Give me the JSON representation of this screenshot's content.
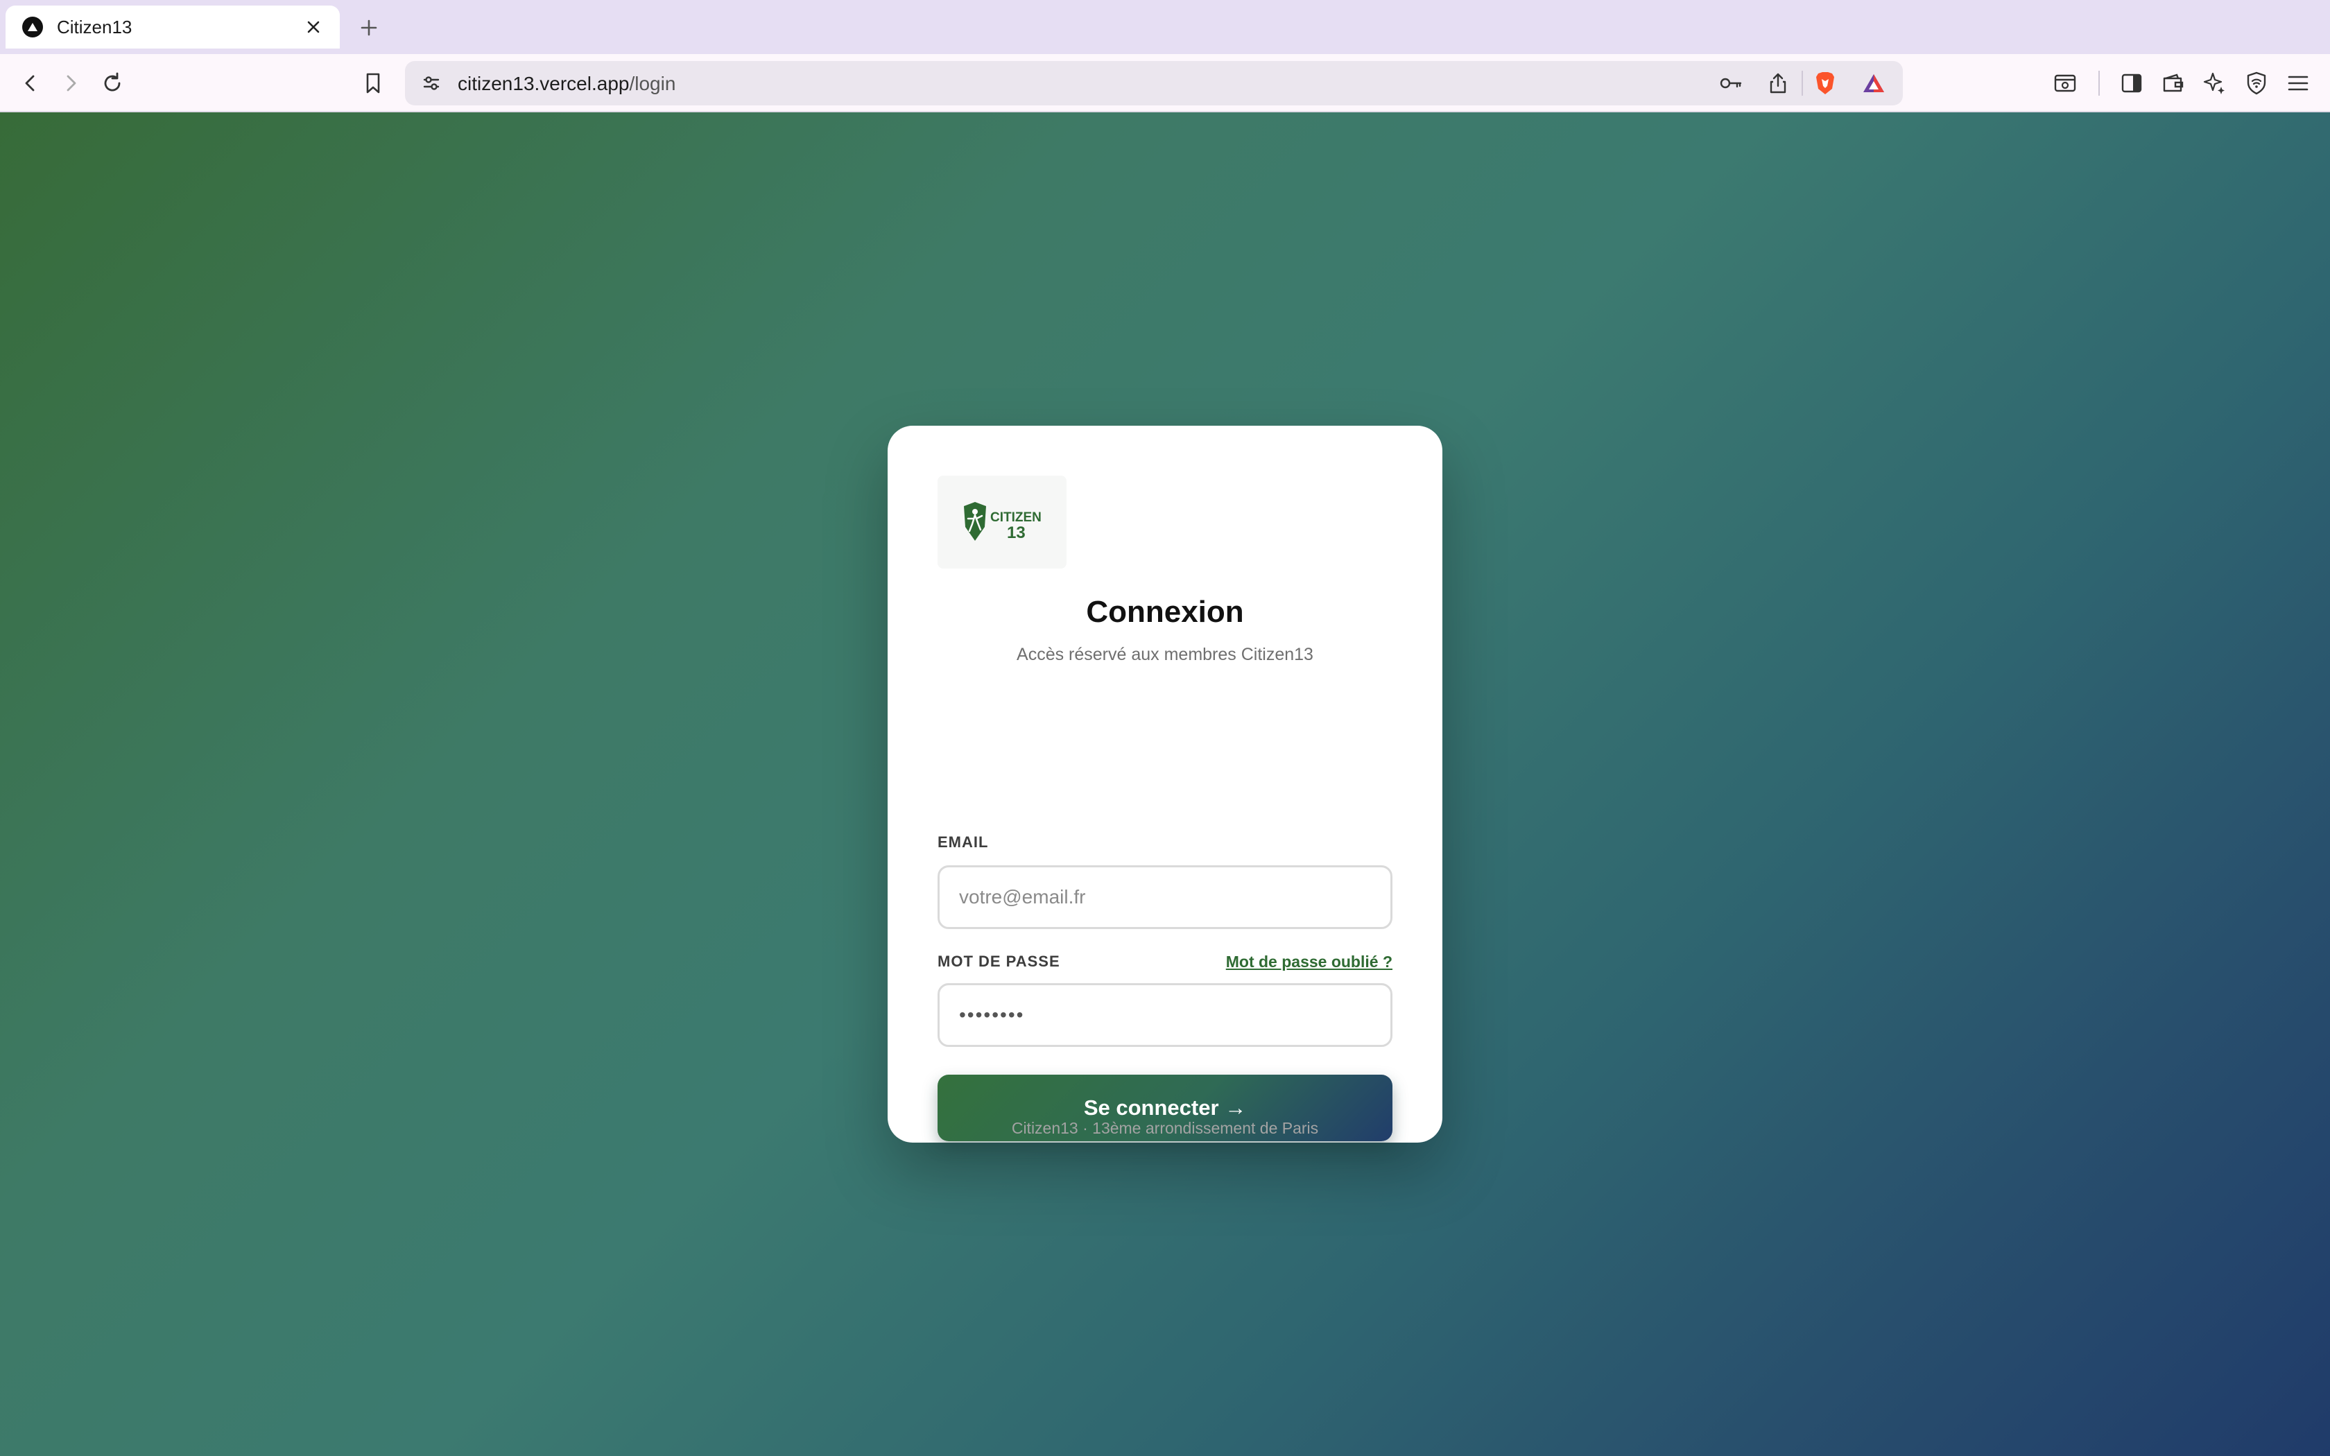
{
  "browser": {
    "tab_title": "Citizen13",
    "url_host": "citizen13.vercel.app",
    "url_path": "/login"
  },
  "icons": [
    "vercel-logo-icon",
    "close-icon",
    "plus-icon",
    "back-icon",
    "forward-icon",
    "reload-icon",
    "bookmark-icon",
    "site-settings-icon",
    "key-icon",
    "share-icon",
    "brave-shields-icon",
    "brave-rewards-icon",
    "screenshot-icon",
    "sidebar-icon",
    "wallet-icon",
    "leo-ai-icon",
    "vpn-icon",
    "menu-icon"
  ],
  "login": {
    "logo_text_top": "CITIZEN",
    "logo_text_bottom": "13",
    "title": "Connexion",
    "subtitle": "Accès réservé aux membres Citizen13",
    "email_label": "EMAIL",
    "email_placeholder": "votre@email.fr",
    "password_label": "MOT DE PASSE",
    "password_placeholder": "••••••••",
    "forgot_link": "Mot de passe oublié ?",
    "submit_label": "Se connecter →",
    "footer": "Citizen13 · 13ème arrondissement de Paris"
  },
  "colors": {
    "brand_green": "#2f6b33",
    "gradient_start": "#376b38",
    "gradient_end": "#203b6a"
  }
}
